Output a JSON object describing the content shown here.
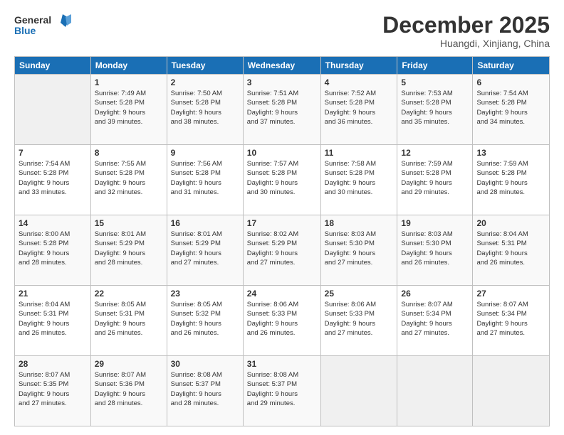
{
  "header": {
    "logo_line1": "General",
    "logo_line2": "Blue",
    "month": "December 2025",
    "location": "Huangdi, Xinjiang, China"
  },
  "weekdays": [
    "Sunday",
    "Monday",
    "Tuesday",
    "Wednesday",
    "Thursday",
    "Friday",
    "Saturday"
  ],
  "weeks": [
    [
      {
        "day": "",
        "info": ""
      },
      {
        "day": "1",
        "info": "Sunrise: 7:49 AM\nSunset: 5:28 PM\nDaylight: 9 hours\nand 39 minutes."
      },
      {
        "day": "2",
        "info": "Sunrise: 7:50 AM\nSunset: 5:28 PM\nDaylight: 9 hours\nand 38 minutes."
      },
      {
        "day": "3",
        "info": "Sunrise: 7:51 AM\nSunset: 5:28 PM\nDaylight: 9 hours\nand 37 minutes."
      },
      {
        "day": "4",
        "info": "Sunrise: 7:52 AM\nSunset: 5:28 PM\nDaylight: 9 hours\nand 36 minutes."
      },
      {
        "day": "5",
        "info": "Sunrise: 7:53 AM\nSunset: 5:28 PM\nDaylight: 9 hours\nand 35 minutes."
      },
      {
        "day": "6",
        "info": "Sunrise: 7:54 AM\nSunset: 5:28 PM\nDaylight: 9 hours\nand 34 minutes."
      }
    ],
    [
      {
        "day": "7",
        "info": "Sunrise: 7:54 AM\nSunset: 5:28 PM\nDaylight: 9 hours\nand 33 minutes."
      },
      {
        "day": "8",
        "info": "Sunrise: 7:55 AM\nSunset: 5:28 PM\nDaylight: 9 hours\nand 32 minutes."
      },
      {
        "day": "9",
        "info": "Sunrise: 7:56 AM\nSunset: 5:28 PM\nDaylight: 9 hours\nand 31 minutes."
      },
      {
        "day": "10",
        "info": "Sunrise: 7:57 AM\nSunset: 5:28 PM\nDaylight: 9 hours\nand 30 minutes."
      },
      {
        "day": "11",
        "info": "Sunrise: 7:58 AM\nSunset: 5:28 PM\nDaylight: 9 hours\nand 30 minutes."
      },
      {
        "day": "12",
        "info": "Sunrise: 7:59 AM\nSunset: 5:28 PM\nDaylight: 9 hours\nand 29 minutes."
      },
      {
        "day": "13",
        "info": "Sunrise: 7:59 AM\nSunset: 5:28 PM\nDaylight: 9 hours\nand 28 minutes."
      }
    ],
    [
      {
        "day": "14",
        "info": "Sunrise: 8:00 AM\nSunset: 5:28 PM\nDaylight: 9 hours\nand 28 minutes."
      },
      {
        "day": "15",
        "info": "Sunrise: 8:01 AM\nSunset: 5:29 PM\nDaylight: 9 hours\nand 28 minutes."
      },
      {
        "day": "16",
        "info": "Sunrise: 8:01 AM\nSunset: 5:29 PM\nDaylight: 9 hours\nand 27 minutes."
      },
      {
        "day": "17",
        "info": "Sunrise: 8:02 AM\nSunset: 5:29 PM\nDaylight: 9 hours\nand 27 minutes."
      },
      {
        "day": "18",
        "info": "Sunrise: 8:03 AM\nSunset: 5:30 PM\nDaylight: 9 hours\nand 27 minutes."
      },
      {
        "day": "19",
        "info": "Sunrise: 8:03 AM\nSunset: 5:30 PM\nDaylight: 9 hours\nand 26 minutes."
      },
      {
        "day": "20",
        "info": "Sunrise: 8:04 AM\nSunset: 5:31 PM\nDaylight: 9 hours\nand 26 minutes."
      }
    ],
    [
      {
        "day": "21",
        "info": "Sunrise: 8:04 AM\nSunset: 5:31 PM\nDaylight: 9 hours\nand 26 minutes."
      },
      {
        "day": "22",
        "info": "Sunrise: 8:05 AM\nSunset: 5:31 PM\nDaylight: 9 hours\nand 26 minutes."
      },
      {
        "day": "23",
        "info": "Sunrise: 8:05 AM\nSunset: 5:32 PM\nDaylight: 9 hours\nand 26 minutes."
      },
      {
        "day": "24",
        "info": "Sunrise: 8:06 AM\nSunset: 5:33 PM\nDaylight: 9 hours\nand 26 minutes."
      },
      {
        "day": "25",
        "info": "Sunrise: 8:06 AM\nSunset: 5:33 PM\nDaylight: 9 hours\nand 27 minutes."
      },
      {
        "day": "26",
        "info": "Sunrise: 8:07 AM\nSunset: 5:34 PM\nDaylight: 9 hours\nand 27 minutes."
      },
      {
        "day": "27",
        "info": "Sunrise: 8:07 AM\nSunset: 5:34 PM\nDaylight: 9 hours\nand 27 minutes."
      }
    ],
    [
      {
        "day": "28",
        "info": "Sunrise: 8:07 AM\nSunset: 5:35 PM\nDaylight: 9 hours\nand 27 minutes."
      },
      {
        "day": "29",
        "info": "Sunrise: 8:07 AM\nSunset: 5:36 PM\nDaylight: 9 hours\nand 28 minutes."
      },
      {
        "day": "30",
        "info": "Sunrise: 8:08 AM\nSunset: 5:37 PM\nDaylight: 9 hours\nand 28 minutes."
      },
      {
        "day": "31",
        "info": "Sunrise: 8:08 AM\nSunset: 5:37 PM\nDaylight: 9 hours\nand 29 minutes."
      },
      {
        "day": "",
        "info": ""
      },
      {
        "day": "",
        "info": ""
      },
      {
        "day": "",
        "info": ""
      }
    ]
  ]
}
